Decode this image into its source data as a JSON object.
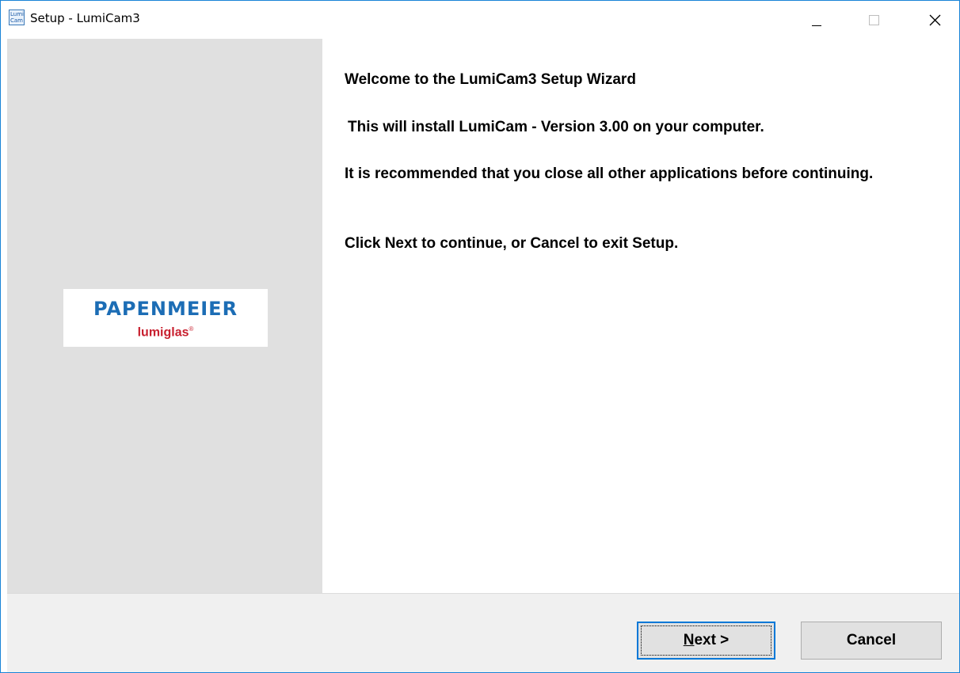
{
  "window": {
    "title": "Setup - LumiCam3",
    "app_icon_text": "Lumi Cam",
    "accent_color": "#1883d7",
    "controls": [
      "minimize-icon",
      "maximize-icon",
      "close-icon"
    ]
  },
  "sidebar": {
    "logo_main": "PAPENMEIER",
    "logo_sub": "lumiglas",
    "logo_sub_mark": "®",
    "logo_main_color": "#1c6db5",
    "logo_sub_color": "#c8202f"
  },
  "content": {
    "title": "Welcome to the LumiCam3 Setup Wizard",
    "install_text": "This will install LumiCam - Version 3.00 on your computer.",
    "recommend_text": "It is recommended that you close all other applications before continuing.",
    "click_text": "Click Next to continue, or Cancel to exit Setup."
  },
  "buttons": {
    "next_mnemonic": "N",
    "next_rest": "ext >",
    "cancel": "Cancel"
  }
}
